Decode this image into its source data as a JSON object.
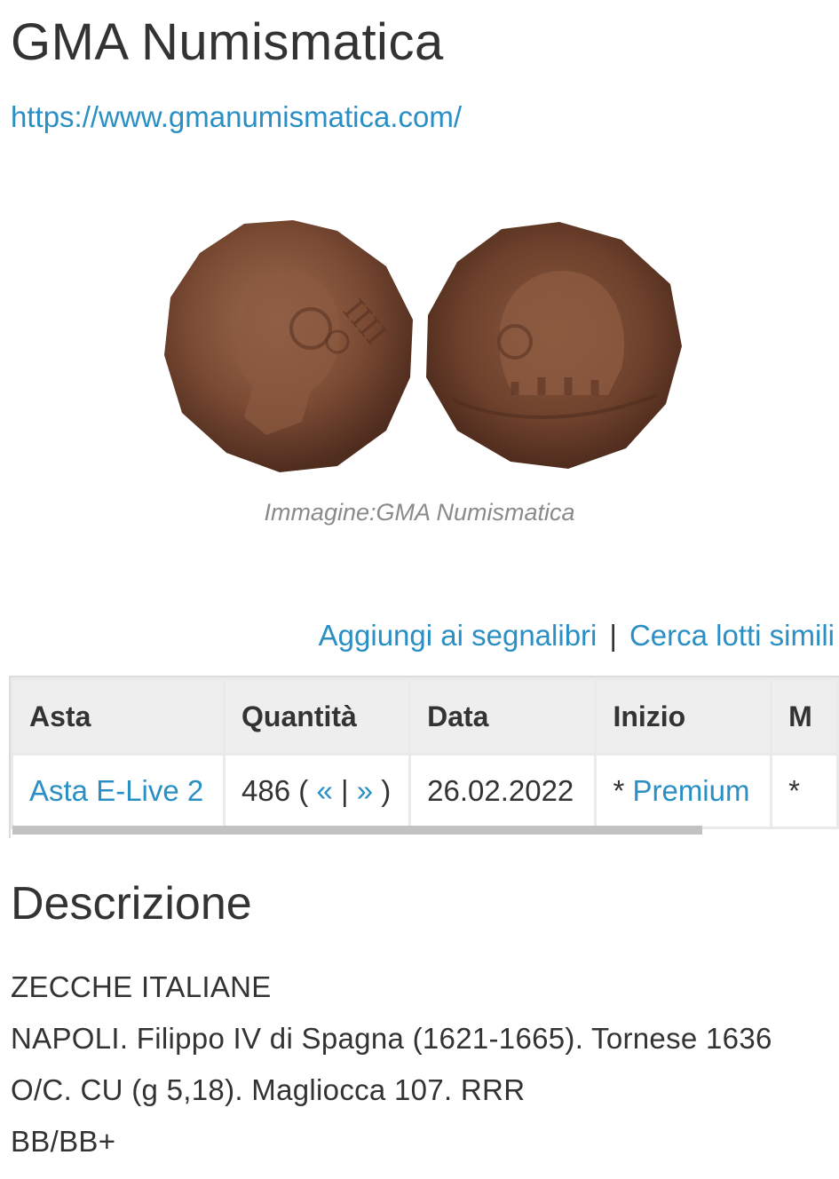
{
  "header": {
    "title": "GMA Numismatica",
    "url": "https://www.gmanumismatica.com/"
  },
  "image": {
    "caption": "Immagine:GMA Numismatica",
    "alt": "Tornese coin obverse and reverse"
  },
  "actions": {
    "bookmark": "Aggiungi ai segnalibri",
    "separator": "|",
    "similar": "Cerca lotti simili"
  },
  "table": {
    "headers": {
      "asta": "Asta",
      "quantita": "Quantità",
      "data": "Data",
      "inizio": "Inizio",
      "next": "M"
    },
    "row": {
      "asta": "Asta E-Live 2",
      "lot_number": "486",
      "open_paren": "(",
      "prev": "«",
      "nav_sep": "|",
      "next": "»",
      "close_paren": ")",
      "data": "26.02.2022",
      "inizio_prefix": "*",
      "inizio_link": "Premium",
      "next_col": "*"
    }
  },
  "description": {
    "heading": "Descrizione",
    "lines": [
      "ZECCHE ITALIANE",
      "NAPOLI. Filippo IV di Spagna (1621-1665). Tornese 1636",
      "O/C. CU (g 5,18). Magliocca 107. RRR",
      "BB/BB+"
    ]
  },
  "colors": {
    "link": "#2a8fc4",
    "text": "#333333",
    "caption": "#8a8a8a",
    "coin_base": "#7a4a33"
  }
}
